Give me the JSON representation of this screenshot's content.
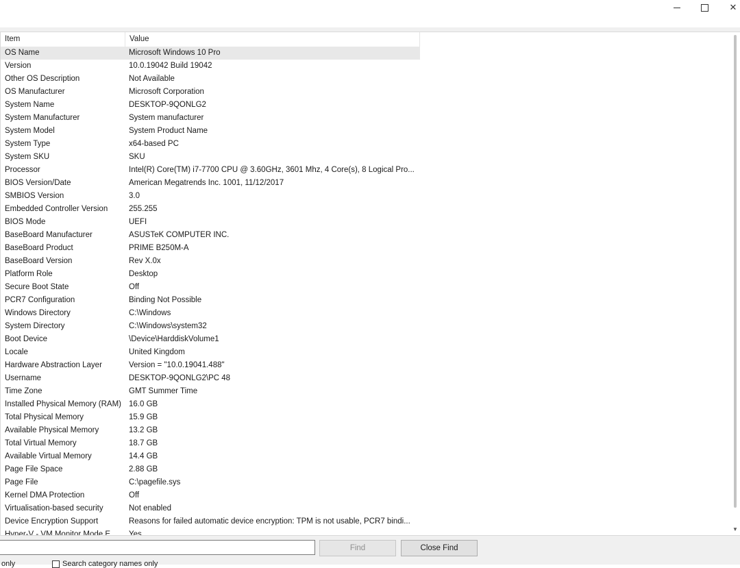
{
  "window": {
    "minimize_icon": "minimize-icon",
    "maximize_icon": "maximize-icon",
    "close_glyph": "✕"
  },
  "table": {
    "columns": [
      "Item",
      "Value"
    ],
    "rows": [
      {
        "item": "OS Name",
        "value": "Microsoft Windows 10 Pro"
      },
      {
        "item": "Version",
        "value": "10.0.19042 Build 19042"
      },
      {
        "item": "Other OS Description",
        "value": "Not Available"
      },
      {
        "item": "OS Manufacturer",
        "value": "Microsoft Corporation"
      },
      {
        "item": "System Name",
        "value": "DESKTOP-9QONLG2"
      },
      {
        "item": "System Manufacturer",
        "value": "System manufacturer"
      },
      {
        "item": "System Model",
        "value": "System Product Name"
      },
      {
        "item": "System Type",
        "value": "x64-based PC"
      },
      {
        "item": "System SKU",
        "value": "SKU"
      },
      {
        "item": "Processor",
        "value": "Intel(R) Core(TM) i7-7700 CPU @ 3.60GHz, 3601 Mhz, 4 Core(s), 8 Logical Pro..."
      },
      {
        "item": "BIOS Version/Date",
        "value": "American Megatrends Inc. 1001, 11/12/2017"
      },
      {
        "item": "SMBIOS Version",
        "value": "3.0"
      },
      {
        "item": "Embedded Controller Version",
        "value": "255.255"
      },
      {
        "item": "BIOS Mode",
        "value": "UEFI"
      },
      {
        "item": "BaseBoard Manufacturer",
        "value": "ASUSTeK COMPUTER INC."
      },
      {
        "item": "BaseBoard Product",
        "value": "PRIME B250M-A"
      },
      {
        "item": "BaseBoard Version",
        "value": "Rev X.0x"
      },
      {
        "item": "Platform Role",
        "value": "Desktop"
      },
      {
        "item": "Secure Boot State",
        "value": "Off"
      },
      {
        "item": "PCR7 Configuration",
        "value": "Binding Not Possible"
      },
      {
        "item": "Windows Directory",
        "value": "C:\\Windows"
      },
      {
        "item": "System Directory",
        "value": "C:\\Windows\\system32"
      },
      {
        "item": "Boot Device",
        "value": "\\Device\\HarddiskVolume1"
      },
      {
        "item": "Locale",
        "value": "United Kingdom"
      },
      {
        "item": "Hardware Abstraction Layer",
        "value": "Version = \"10.0.19041.488\""
      },
      {
        "item": "Username",
        "value": "DESKTOP-9QONLG2\\PC 48"
      },
      {
        "item": "Time Zone",
        "value": "GMT Summer Time"
      },
      {
        "item": "Installed Physical Memory (RAM)",
        "value": "16.0 GB"
      },
      {
        "item": "Total Physical Memory",
        "value": "15.9 GB"
      },
      {
        "item": "Available Physical Memory",
        "value": "13.2 GB"
      },
      {
        "item": "Total Virtual Memory",
        "value": "18.7 GB"
      },
      {
        "item": "Available Virtual Memory",
        "value": "14.4 GB"
      },
      {
        "item": "Page File Space",
        "value": "2.88 GB"
      },
      {
        "item": "Page File",
        "value": "C:\\pagefile.sys"
      },
      {
        "item": "Kernel DMA Protection",
        "value": "Off"
      },
      {
        "item": "Virtualisation-based security",
        "value": "Not enabled"
      },
      {
        "item": "Device Encryption Support",
        "value": "Reasons for failed automatic device encryption: TPM is not usable, PCR7 bindi..."
      },
      {
        "item": "Hyper-V - VM Monitor Mode E...",
        "value": "Yes"
      }
    ]
  },
  "findbar": {
    "find_label": "Find",
    "close_find_label": "Close Find",
    "option_left_text": "only",
    "option_right_text": "Search category names only",
    "find_input_value": ""
  }
}
